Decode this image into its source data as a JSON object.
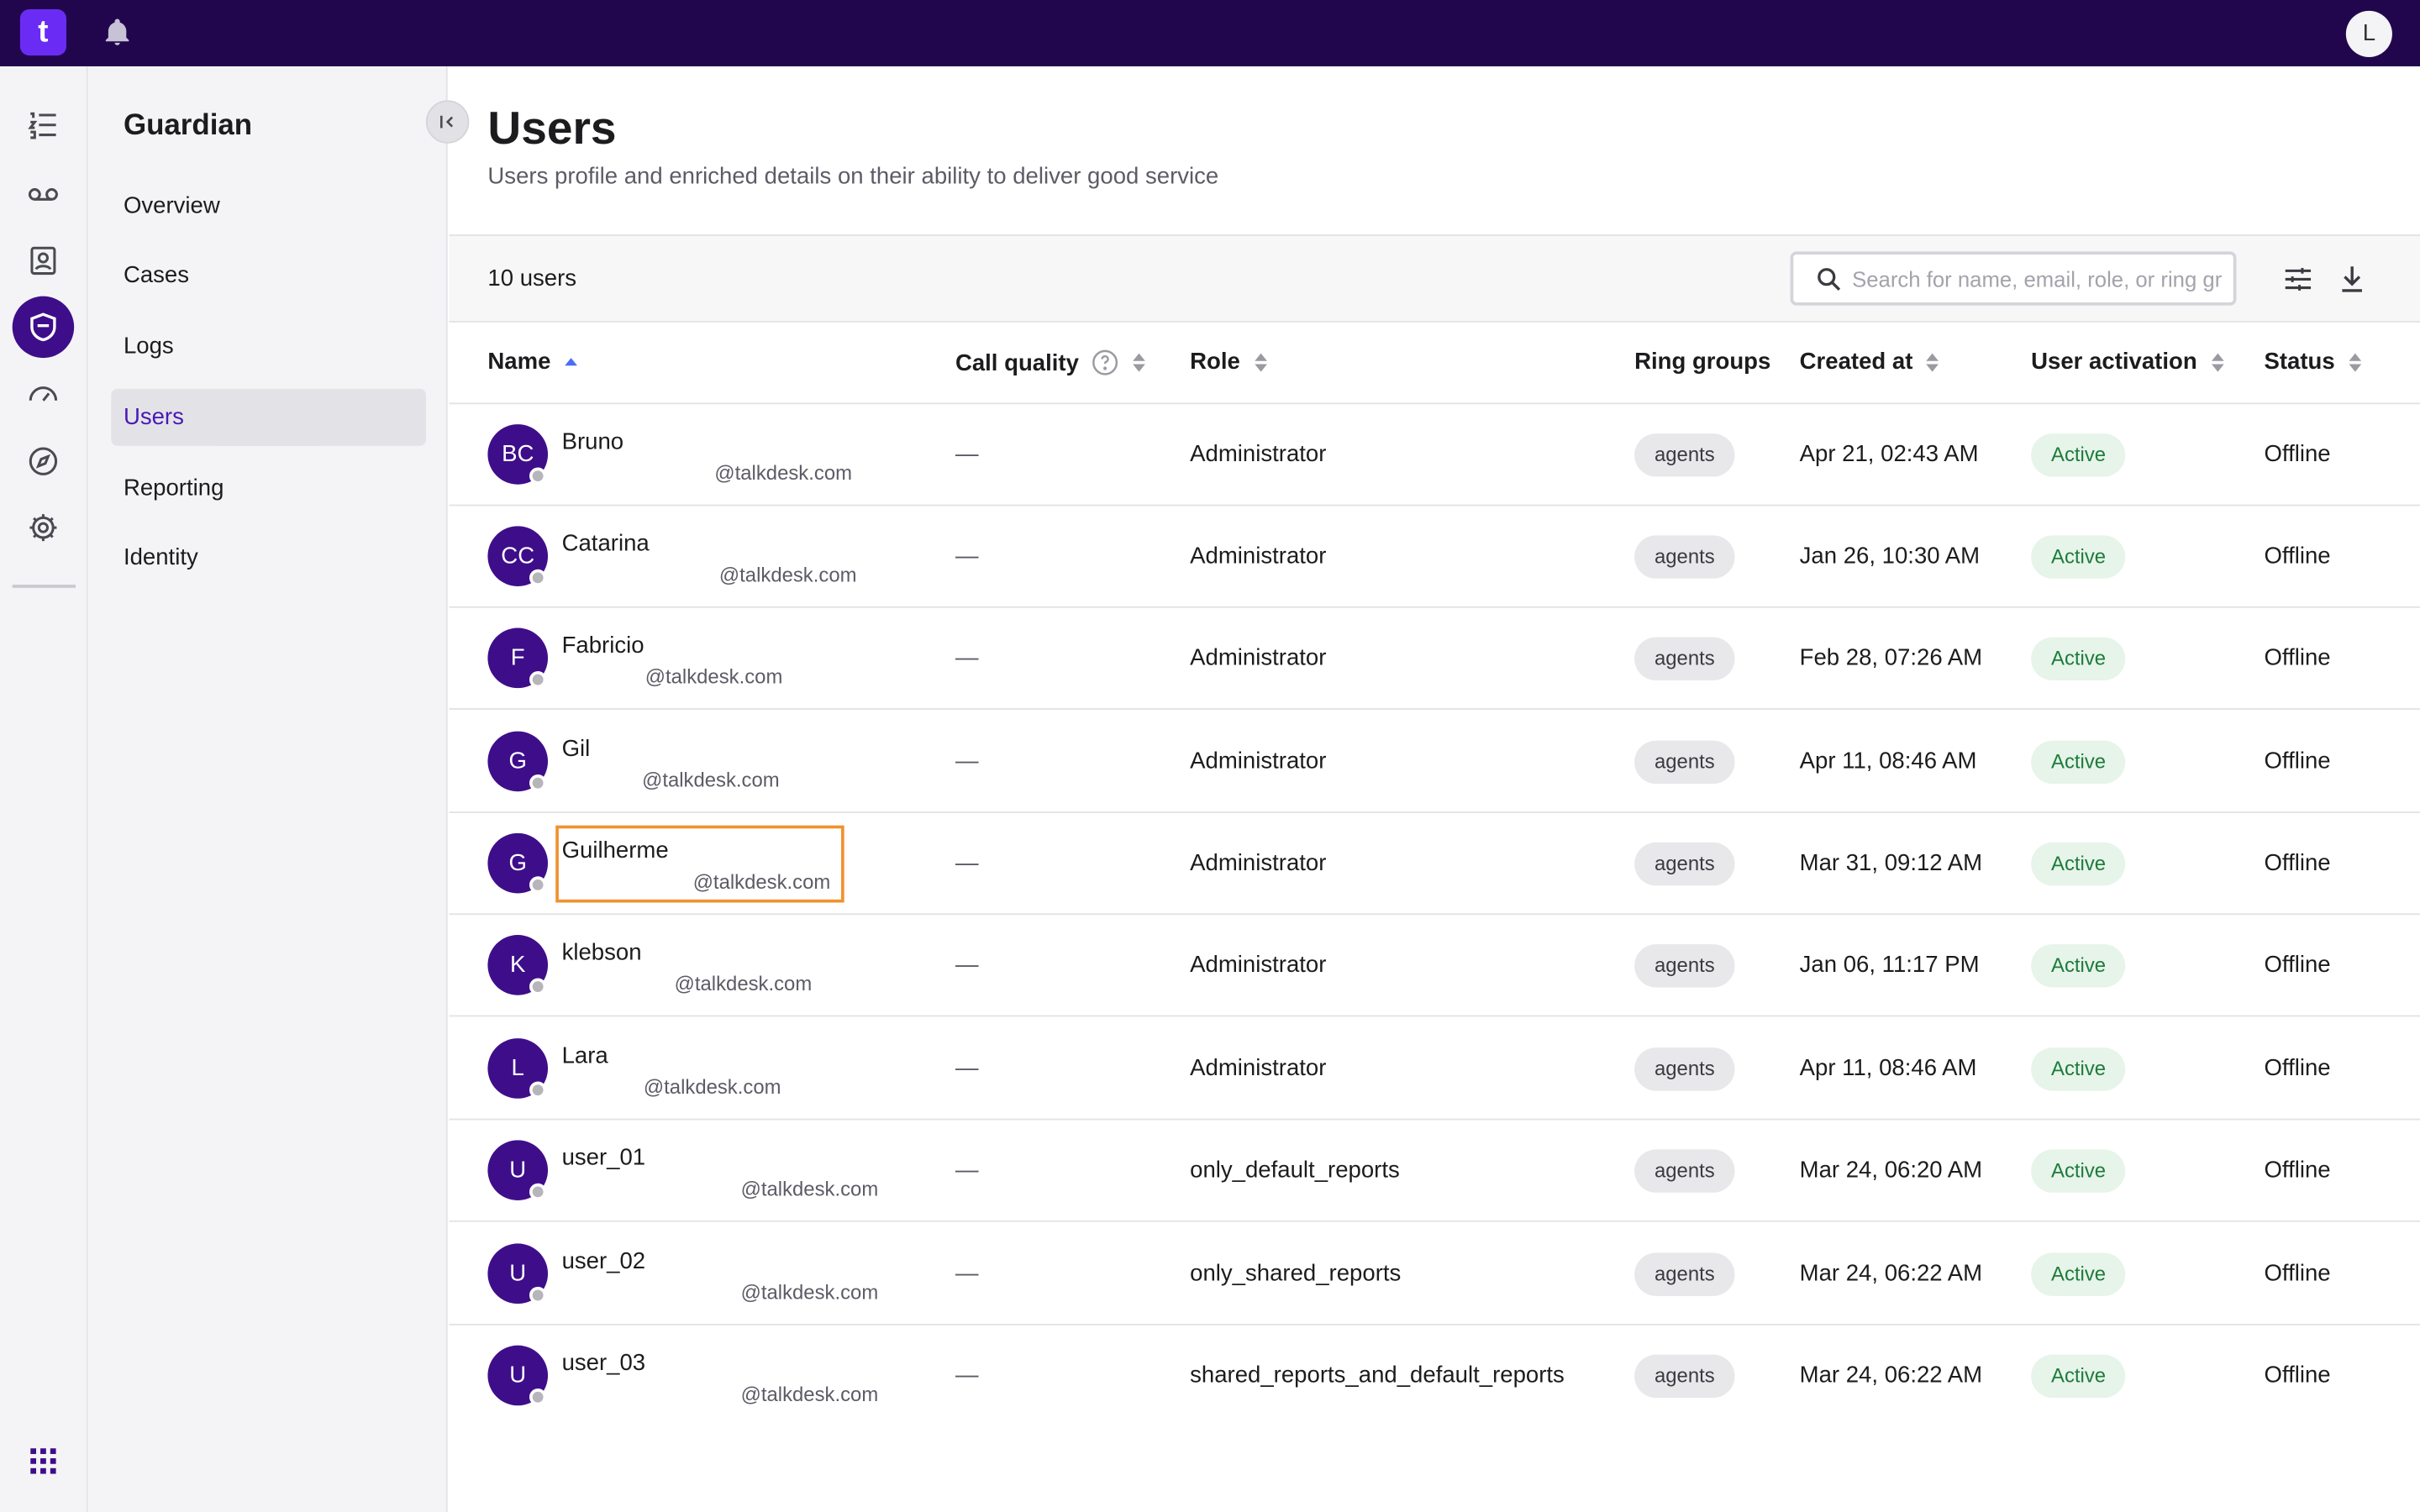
{
  "topbar": {
    "logo": "t",
    "user_initial": "L"
  },
  "subnav": {
    "title": "Guardian",
    "items": [
      "Overview",
      "Cases",
      "Logs",
      "Users",
      "Reporting",
      "Identity"
    ],
    "active": "Users"
  },
  "page": {
    "title": "Users",
    "subtitle": "Users profile and enriched details on their ability to deliver good service"
  },
  "toolbar": {
    "count": "10 users",
    "search_placeholder": "Search for name, email, role, or ring group"
  },
  "columns": {
    "name": "Name",
    "call_quality": "Call quality",
    "role": "Role",
    "ring_groups": "Ring groups",
    "created_at": "Created at",
    "user_activation": "User activation",
    "status": "Status"
  },
  "users": [
    {
      "initials": "BC",
      "name": "Bruno",
      "email": "@talkdesk.com",
      "call_quality": "—",
      "role": "Administrator",
      "ring_group": "agents",
      "created": "Apr 21, 02:43 AM",
      "activation": "Active",
      "status": "Offline"
    },
    {
      "initials": "CC",
      "name": "Catarina",
      "email": "@talkdesk.com",
      "call_quality": "—",
      "role": "Administrator",
      "ring_group": "agents",
      "created": "Jan 26, 10:30 AM",
      "activation": "Active",
      "status": "Offline"
    },
    {
      "initials": "F",
      "name": "Fabricio",
      "email": "@talkdesk.com",
      "call_quality": "—",
      "role": "Administrator",
      "ring_group": "agents",
      "created": "Feb 28, 07:26 AM",
      "activation": "Active",
      "status": "Offline"
    },
    {
      "initials": "G",
      "name": "Gil",
      "email": "@talkdesk.com",
      "call_quality": "—",
      "role": "Administrator",
      "ring_group": "agents",
      "created": "Apr 11, 08:46 AM",
      "activation": "Active",
      "status": "Offline"
    },
    {
      "initials": "G",
      "name": "Guilherme",
      "email": "@talkdesk.com",
      "call_quality": "—",
      "role": "Administrator",
      "ring_group": "agents",
      "created": "Mar 31, 09:12 AM",
      "activation": "Active",
      "status": "Offline"
    },
    {
      "initials": "K",
      "name": "klebson",
      "email": "@talkdesk.com",
      "call_quality": "—",
      "role": "Administrator",
      "ring_group": "agents",
      "created": "Jan 06, 11:17 PM",
      "activation": "Active",
      "status": "Offline"
    },
    {
      "initials": "L",
      "name": "Lara",
      "email": "@talkdesk.com",
      "call_quality": "—",
      "role": "Administrator",
      "ring_group": "agents",
      "created": "Apr 11, 08:46 AM",
      "activation": "Active",
      "status": "Offline"
    },
    {
      "initials": "U",
      "name": "user_01",
      "email": "@talkdesk.com",
      "call_quality": "—",
      "role": "only_default_reports",
      "ring_group": "agents",
      "created": "Mar 24, 06:20 AM",
      "activation": "Active",
      "status": "Offline"
    },
    {
      "initials": "U",
      "name": "user_02",
      "email": "@talkdesk.com",
      "call_quality": "—",
      "role": "only_shared_reports",
      "ring_group": "agents",
      "created": "Mar 24, 06:22 AM",
      "activation": "Active",
      "status": "Offline"
    },
    {
      "initials": "U",
      "name": "user_03",
      "email": "@talkdesk.com",
      "call_quality": "—",
      "role": "shared_reports_and_default_reports",
      "ring_group": "agents",
      "created": "Mar 24, 06:22 AM",
      "activation": "Active",
      "status": "Offline"
    }
  ],
  "colors": {
    "topbar": "#22064d",
    "accent": "#3e0e8a",
    "active_badge_bg": "#e6f4ea",
    "active_badge_text": "#1e7b3a",
    "highlight": "#f0922f"
  }
}
